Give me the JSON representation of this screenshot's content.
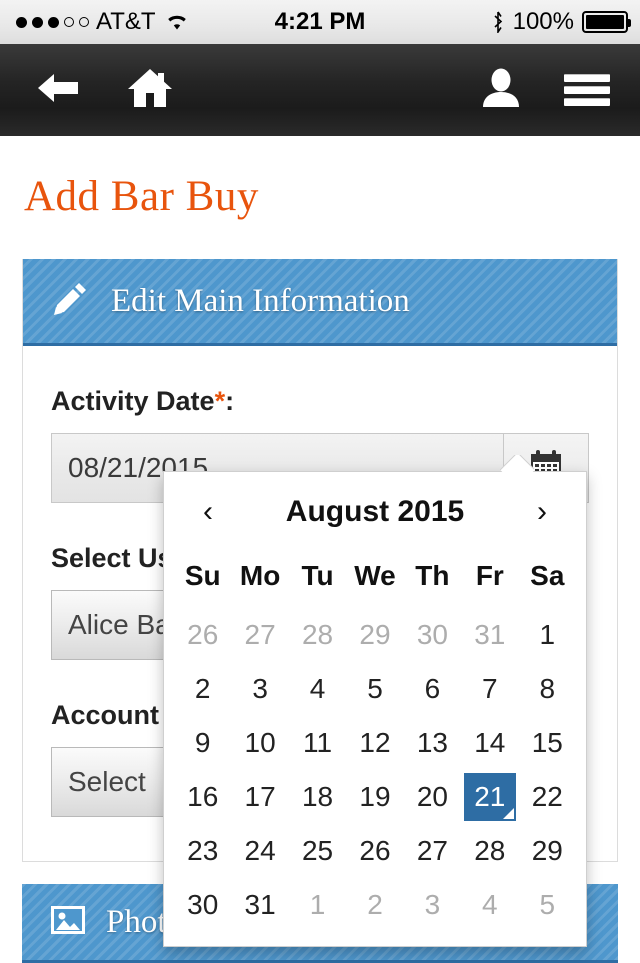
{
  "status_bar": {
    "signal_dots_filled": 3,
    "signal_dots_total": 5,
    "carrier": "AT&T",
    "wifi_icon": "wifi-icon",
    "time": "4:21 PM",
    "bluetooth_icon": "bluetooth-icon",
    "battery_percent": "100%",
    "battery_level": 100
  },
  "nav_bar": {
    "back_icon": "back-arrow-icon",
    "home_icon": "home-icon",
    "account_icon": "user-icon",
    "menu_icon": "hamburger-menu-icon"
  },
  "page": {
    "title": "Add Bar Buy",
    "title_color": "#e8540d"
  },
  "main_panel": {
    "header_title": "Edit Main Information",
    "header_icon": "pencil-icon",
    "header_color": "#4e97cd",
    "fields": {
      "activity_date": {
        "label": "Activity Date",
        "required_mark": "*",
        "label_suffix": ":",
        "value": "08/21/2015",
        "calendar_icon": "calendar-icon"
      },
      "select_user": {
        "label": "Select Us",
        "value": "Alice Ball"
      },
      "account_name": {
        "label": "Account N",
        "value": "Select"
      }
    }
  },
  "photos_panel": {
    "header_title": "Photo",
    "header_icon": "image-icon"
  },
  "datepicker": {
    "prev_label": "‹",
    "next_label": "›",
    "month_title": "August 2015",
    "weekdays": [
      "Su",
      "Mo",
      "Tu",
      "We",
      "Th",
      "Fr",
      "Sa"
    ],
    "selected_day": 21,
    "selected_color": "#2e6da4",
    "weeks": [
      [
        {
          "d": "26",
          "muted": true
        },
        {
          "d": "27",
          "muted": true
        },
        {
          "d": "28",
          "muted": true
        },
        {
          "d": "29",
          "muted": true
        },
        {
          "d": "30",
          "muted": true
        },
        {
          "d": "31",
          "muted": true
        },
        {
          "d": "1",
          "muted": false
        }
      ],
      [
        {
          "d": "2",
          "muted": false
        },
        {
          "d": "3",
          "muted": false
        },
        {
          "d": "4",
          "muted": false
        },
        {
          "d": "5",
          "muted": false
        },
        {
          "d": "6",
          "muted": false
        },
        {
          "d": "7",
          "muted": false
        },
        {
          "d": "8",
          "muted": false
        }
      ],
      [
        {
          "d": "9",
          "muted": false
        },
        {
          "d": "10",
          "muted": false
        },
        {
          "d": "11",
          "muted": false
        },
        {
          "d": "12",
          "muted": false
        },
        {
          "d": "13",
          "muted": false
        },
        {
          "d": "14",
          "muted": false
        },
        {
          "d": "15",
          "muted": false
        }
      ],
      [
        {
          "d": "16",
          "muted": false
        },
        {
          "d": "17",
          "muted": false
        },
        {
          "d": "18",
          "muted": false
        },
        {
          "d": "19",
          "muted": false
        },
        {
          "d": "20",
          "muted": false
        },
        {
          "d": "21",
          "muted": false,
          "selected": true
        },
        {
          "d": "22",
          "muted": false
        }
      ],
      [
        {
          "d": "23",
          "muted": false
        },
        {
          "d": "24",
          "muted": false
        },
        {
          "d": "25",
          "muted": false
        },
        {
          "d": "26",
          "muted": false
        },
        {
          "d": "27",
          "muted": false
        },
        {
          "d": "28",
          "muted": false
        },
        {
          "d": "29",
          "muted": false
        }
      ],
      [
        {
          "d": "30",
          "muted": false
        },
        {
          "d": "31",
          "muted": false
        },
        {
          "d": "1",
          "muted": true
        },
        {
          "d": "2",
          "muted": true
        },
        {
          "d": "3",
          "muted": true
        },
        {
          "d": "4",
          "muted": true
        },
        {
          "d": "5",
          "muted": true
        }
      ]
    ]
  }
}
